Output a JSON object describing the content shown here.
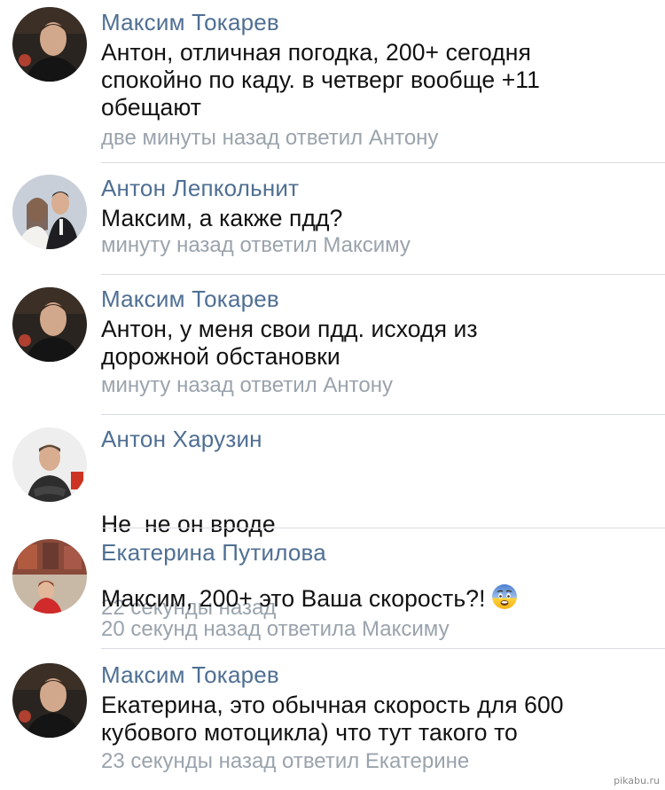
{
  "comments": [
    {
      "author": "Максим Токарев",
      "text_lines": [
        "Антон, отличная погодка, 200+ сегодня",
        "спокойно по каду. в четверг вообще +11",
        "обещают"
      ],
      "meta": "две минуты назад ответил Антону",
      "avatar_icon": "user-avatar-maksim"
    },
    {
      "author": "Антон Лепкольнит",
      "text_lines": [
        "Максим, а какже пдд?"
      ],
      "meta": "минуту назад ответил Максиму",
      "avatar_icon": "user-avatar-anton-l"
    },
    {
      "author": "Максим Токарев",
      "text_lines": [
        "Антон, у меня свои пдд. исходя из",
        "дорожной обстановки"
      ],
      "meta": "минуту назад ответил Антону",
      "avatar_icon": "user-avatar-maksim"
    },
    {
      "author": "Антон Харузин",
      "text_lines": [
        "Не  не он вроде"
      ],
      "meta": "22 секунды назад",
      "avatar_icon": "user-avatar-anton-h"
    },
    {
      "author": "Екатерина Путилова",
      "text_lines": [
        "Максим, 200+ это Ваша скорость?!"
      ],
      "emoji": "fearful-face",
      "meta": "20 секунд назад ответила Максиму",
      "avatar_icon": "user-avatar-ekaterina"
    },
    {
      "author": "Максим Токарев",
      "text_lines": [
        "Екатерина, это обычная скорость для 600",
        "кубового мотоцикла) что тут такого то"
      ],
      "meta": "23 секунды назад ответил Екатерине",
      "avatar_icon": "user-avatar-maksim"
    }
  ],
  "colors": {
    "author": "#4f6f93",
    "text": "#111111",
    "meta": "#9aa3ac",
    "divider": "#d8dbe0"
  },
  "watermark": "pikabu.ru"
}
